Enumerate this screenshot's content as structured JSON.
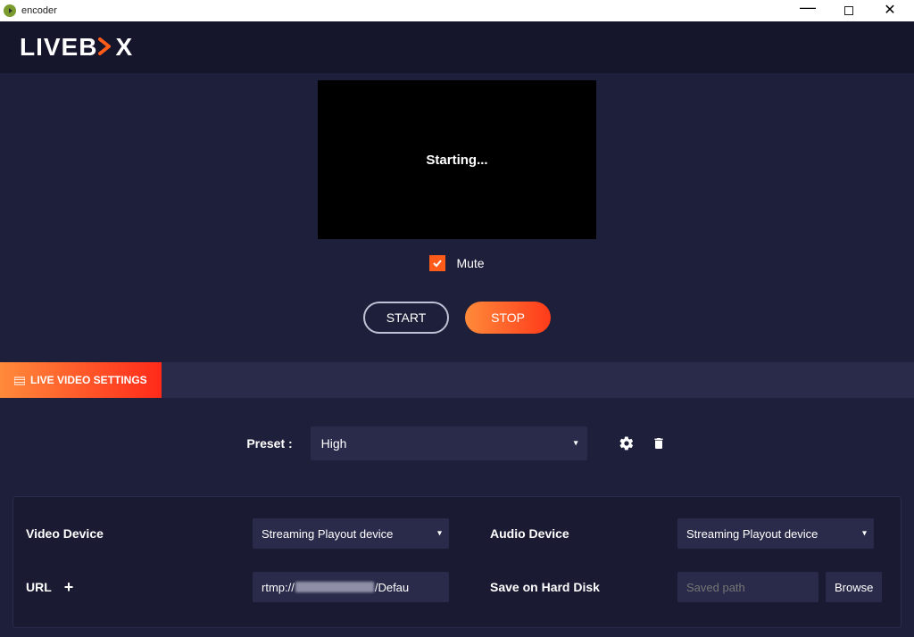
{
  "titlebar": {
    "title": "encoder"
  },
  "brand": {
    "part1": "LIVEB",
    "part2": "X"
  },
  "preview": {
    "status": "Starting..."
  },
  "mute": {
    "label": "Mute"
  },
  "controls": {
    "start": "START",
    "stop": "STOP"
  },
  "tabs": {
    "live_video_settings": "LIVE VIDEO SETTINGS"
  },
  "preset": {
    "label": "Preset :",
    "value": "High"
  },
  "settings": {
    "video_device": {
      "label": "Video Device",
      "value": "Streaming Playout device"
    },
    "audio_device": {
      "label": "Audio Device",
      "value": "Streaming Playout device"
    },
    "url": {
      "label": "URL",
      "prefix": "rtmp://",
      "suffix": "/Defau"
    },
    "save_disk": {
      "label": "Save on Hard Disk",
      "placeholder": "Saved path",
      "browse": "Browse"
    }
  }
}
